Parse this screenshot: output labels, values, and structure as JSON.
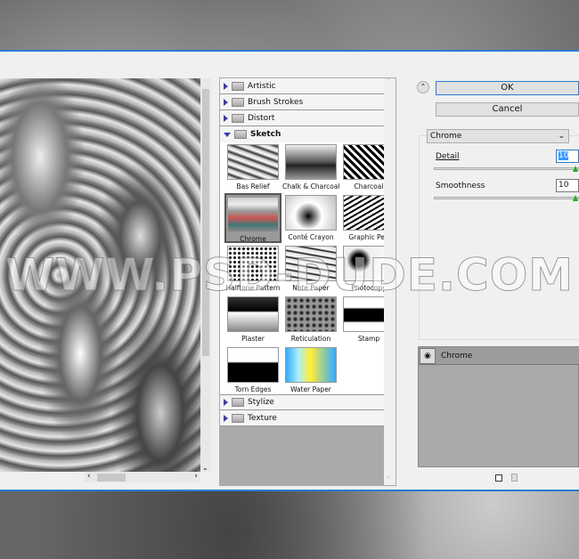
{
  "categories_top": [
    "Artistic",
    "Brush Strokes",
    "Distort"
  ],
  "open_category": "Sketch",
  "thumbnails": [
    "Bas Relief",
    "Chalk & Charcoal",
    "Charcoal",
    "Chrome",
    "Conté Crayon",
    "Graphic Pen",
    "Halftone Pattern",
    "Note Paper",
    "Photocopy",
    "Plaster",
    "Reticulation",
    "Stamp",
    "Torn Edges",
    "Water Paper"
  ],
  "selected_thumbnail": "Chrome",
  "categories_bottom": [
    "Stylize",
    "Texture"
  ],
  "buttons": {
    "ok": "OK",
    "cancel": "Cancel"
  },
  "filter_select": "Chrome",
  "params": [
    {
      "label": "Detail",
      "value": "10"
    },
    {
      "label": "Smoothness",
      "value": "10"
    }
  ],
  "layer": {
    "name": "Chrome"
  },
  "watermark": "WWW.PSD-DUDE.COM"
}
